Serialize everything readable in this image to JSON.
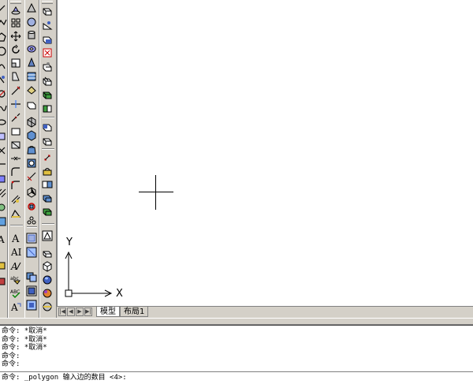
{
  "layout_tabs": {
    "model": "模型",
    "layout1": "布局1"
  },
  "ucs": {
    "x_axis": "X",
    "y_axis": "Y"
  },
  "command_window": {
    "history": [
      "命令: *取消*",
      "命令: *取消*",
      "命令: *取消*",
      "命令:",
      "命令:"
    ],
    "prompt": "命令: _polygon 输入边的数目 <4>:"
  },
  "toolbars": {
    "draw": [
      "line-icon",
      "polyline-icon",
      "polygon-icon",
      "rectangle-icon",
      "arc-icon",
      "circle-icon",
      "revcloud-icon",
      "spline-icon",
      "ellipse-icon",
      "ellipse-arc-icon",
      "insert-block-icon",
      "make-block-icon",
      "point-icon",
      "hatch-icon",
      "gradient-icon",
      "region-icon",
      "table-icon",
      "mtext-icon"
    ],
    "modify": [
      "erase-icon",
      "copy-icon",
      "mirror-icon",
      "offset-icon",
      "array-icon",
      "move-icon",
      "rotate-icon",
      "scale-icon",
      "stretch-icon",
      "trim-icon",
      "extend-icon",
      "break-at-point-icon",
      "break-icon",
      "join-icon",
      "chamfer-icon",
      "fillet-icon",
      "explode-icon",
      "text-icon",
      "mtext-icon",
      "edit-text-icon",
      "find-text-icon",
      "spell-icon",
      "scale-text-icon",
      "justify-text-icon"
    ],
    "modeling": [
      "box-icon",
      "sphere-icon",
      "cylinder-icon",
      "cone-icon",
      "wedge-icon",
      "torus-icon",
      "extrude-icon",
      "revolve-icon",
      "slice-icon",
      "section-icon",
      "interference-icon",
      "setup-drawing-icon",
      "setup-view-icon",
      "setup-profile-icon",
      "union-icon",
      "subtract-icon",
      "intersect-icon",
      "extrude-faces-icon",
      "move-faces-icon",
      "offset-faces-icon",
      "delete-faces-icon",
      "rotate-faces-icon",
      "taper-faces-icon",
      "copy-faces-icon"
    ],
    "view3d": [
      "3d-box-icon",
      "3d-wedge-icon",
      "3d-pyramid-icon",
      "3d-cone-icon",
      "3d-sphere-icon",
      "3d-dome-icon",
      "3d-dish-icon",
      "3d-torus-icon",
      "3d-mesh-icon",
      "3d-face-icon",
      "edge-icon",
      "3d-mesh-surface-icon",
      "revolved-surface-icon",
      "tabulated-surface-icon",
      "ruled-surface-icon",
      "edge-surface-icon",
      "named-views-icon",
      "top-view-icon",
      "bottom-view-icon",
      "left-view-icon",
      "front-view-icon",
      "sw-iso-icon",
      "shade-icon",
      "render-icon",
      "materials-icon"
    ]
  }
}
